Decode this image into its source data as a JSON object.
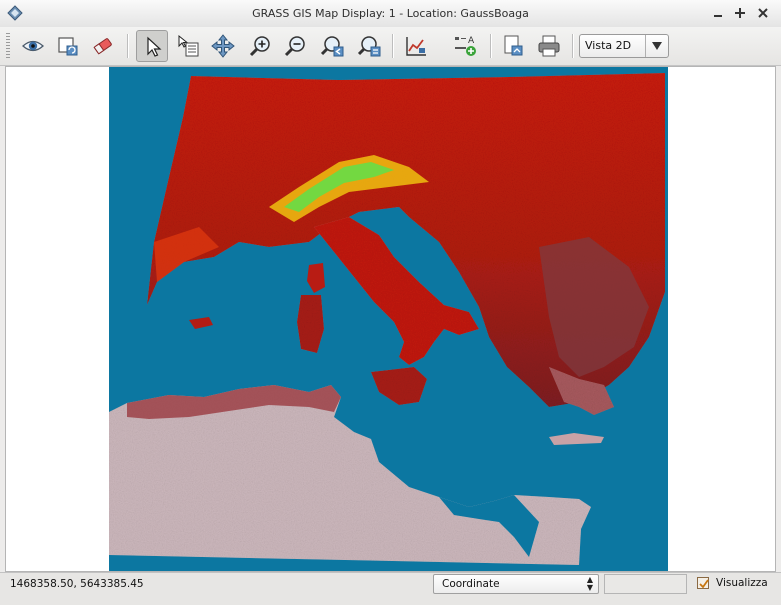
{
  "window": {
    "title": "GRASS GIS Map Display: 1 - Location: GaussBoaga",
    "controls": [
      "minimize",
      "maximize",
      "close"
    ]
  },
  "toolbar": {
    "tools": [
      {
        "name": "display-map-icon",
        "tooltip": "Display map"
      },
      {
        "name": "render-map-icon",
        "tooltip": "Render map"
      },
      {
        "name": "erase-display-icon",
        "tooltip": "Erase display"
      },
      {
        "name": "pointer-icon",
        "tooltip": "Pointer",
        "active": true
      },
      {
        "name": "query-icon",
        "tooltip": "Query raster/vector map(s)"
      },
      {
        "name": "pan-icon",
        "tooltip": "Pan"
      },
      {
        "name": "zoom-in-icon",
        "tooltip": "Zoom in"
      },
      {
        "name": "zoom-out-icon",
        "tooltip": "Zoom out"
      },
      {
        "name": "zoom-back-icon",
        "tooltip": "Return to previous zoom"
      },
      {
        "name": "zoom-menu-icon",
        "tooltip": "Zoom options"
      },
      {
        "name": "analyze-icon",
        "tooltip": "Analyze map"
      },
      {
        "name": "overlay-icon",
        "tooltip": "Add map elements"
      },
      {
        "name": "save-image-icon",
        "tooltip": "Save display to graphic file"
      },
      {
        "name": "print-icon",
        "tooltip": "Print display"
      }
    ],
    "view_mode": "Vista 2D"
  },
  "map": {
    "background_color": "#0c77a1",
    "colors": {
      "land_high": "#d21a0a",
      "land_mid": "#8c1e1e",
      "land_low": "#c9b3b8",
      "peaks": "#5ee04a"
    }
  },
  "statusbar": {
    "coordinates": "1468358.50, 5643385.45",
    "mode": "Coordinate",
    "render_label": "Visualizza",
    "render_checked": true
  }
}
